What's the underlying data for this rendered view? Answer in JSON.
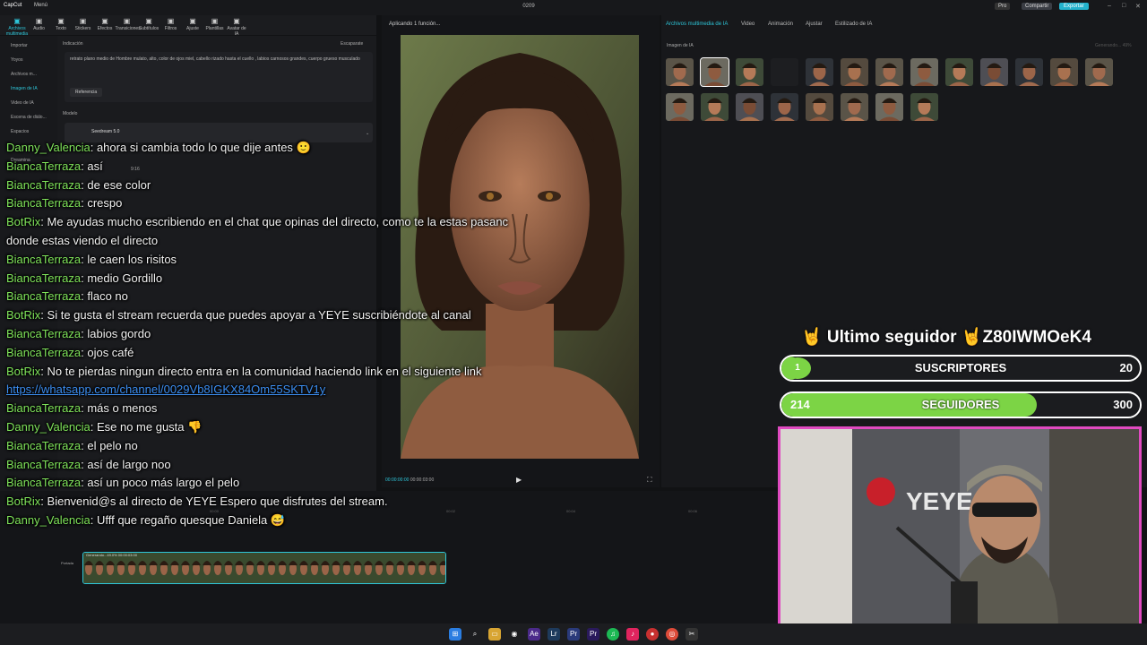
{
  "app": {
    "logo": "CapCut",
    "menu": "Menú",
    "project": "0209",
    "pro": "Pro",
    "share": "Compartir",
    "export": "Exportar"
  },
  "toolbar": [
    "Archivos multimedia",
    "Audio",
    "Texto",
    "Stickers",
    "Efectos",
    "Transiciones",
    "Subtítulos",
    "Filtros",
    "Ajuste",
    "Plantillas",
    "Avatar de IA"
  ],
  "toolbar_icons": [
    "media-icon",
    "audio-icon",
    "text-icon",
    "sticker-icon",
    "effects-icon",
    "transition-icon",
    "subtitles-icon",
    "filter-icon",
    "adjust-icon",
    "template-icon",
    "avatar-icon"
  ],
  "sidebar": [
    "Importar",
    "Yoyos",
    "Archivos m...",
    "Imagen de IA",
    "Video de IA",
    "Escena de diálo...",
    "Espacios",
    "Dreamina"
  ],
  "panel": {
    "indicacion": "Indicación",
    "escaparate": "Escaparate",
    "prompt": "retrato plano medio de Hombre mulato, alto, color de ojos miel, cabello rizado hasta el cuello , labios carnosos grandes, cuerpo grueso musculado",
    "referencia": "Referencia",
    "modelo": "Modelo",
    "model_name": "Seedream 5.0",
    "ratio": "9:16"
  },
  "preview": {
    "status": "Aplicando 1 función...",
    "time": "00:00:00:00",
    "duration": "00:00:03:00"
  },
  "right_tabs": [
    "Archivos multimedia de IA",
    "Video",
    "Animación",
    "Ajustar",
    "Estilizado de IA"
  ],
  "right_panel": {
    "img_label": "Imagen de IA",
    "gen_label": "Generando... 49%"
  },
  "timeline": {
    "clip_label": "Generando...49.0%  00:00:03:00",
    "portada": "Portada",
    "ticks": [
      "00:00",
      "00:02",
      "00:04",
      "00:06"
    ]
  },
  "chat": [
    {
      "user": "Danny_Valencia",
      "msg": "ahora si cambia todo lo que dije antes 🙂"
    },
    {
      "user": "BiancaTerraza",
      "msg": "así"
    },
    {
      "user": "BiancaTerraza",
      "msg": "de ese color"
    },
    {
      "user": "BiancaTerraza",
      "msg": "crespo"
    },
    {
      "user": "BotRix",
      "msg": "Me ayudas mucho escribiendo en el chat que opinas del directo, como te la estas pasanc"
    },
    {
      "user": "",
      "msg": "donde estas viendo el directo"
    },
    {
      "user": "BiancaTerraza",
      "msg": "le caen los risitos"
    },
    {
      "user": "BiancaTerraza",
      "msg": "medio Gordillo"
    },
    {
      "user": "BiancaTerraza",
      "msg": "flaco no"
    },
    {
      "user": "BotRix",
      "msg": "Si te gusta el stream recuerda que puedes apoyar a YEYE suscribiéndote al canal"
    },
    {
      "user": "BiancaTerraza",
      "msg": "labios gordo"
    },
    {
      "user": "BiancaTerraza",
      "msg": "ojos café"
    },
    {
      "user": "BotRix",
      "msg": "No te pierdas ningun directo entra en la comunidad haciendo link en el siguiente link"
    },
    {
      "user": "",
      "msg": "https://whatsapp.com/channel/0029Vb8IGKX84Om55SKTV1y",
      "link": true
    },
    {
      "user": "BiancaTerraza",
      "msg": "más o menos"
    },
    {
      "user": "Danny_Valencia",
      "msg": "Ese no me gusta 👎"
    },
    {
      "user": "BiancaTerraza",
      "msg": "el pelo no"
    },
    {
      "user": "BiancaTerraza",
      "msg": "así de largo noo"
    },
    {
      "user": "BiancaTerraza",
      "msg": "así un poco más largo el pelo"
    },
    {
      "user": "BotRix",
      "msg": "Bienvenid@s al directo de YEYE Espero que disfrutes del stream."
    },
    {
      "user": "Danny_Valencia",
      "msg": "Ufff que regaño quesque Daniela 😅"
    }
  ],
  "overlay": {
    "seguidor": "🤘 Ultimo seguidor 🤘Z80IWMOeK4",
    "subs_label": "SUSCRIPTORES",
    "subs_current": "1",
    "subs_goal": "20",
    "subs_fraction": 0.05,
    "segs_label": "SEGUIDORES",
    "segs_current": "214",
    "segs_goal": "300",
    "segs_fraction": 0.713,
    "cam_sign": "YEYE"
  },
  "colors": {
    "accent": "#2ec6d9",
    "chat_user": "#7fe35a",
    "bar_fill": "#7cd445",
    "cam_border": "#e04ac0"
  }
}
